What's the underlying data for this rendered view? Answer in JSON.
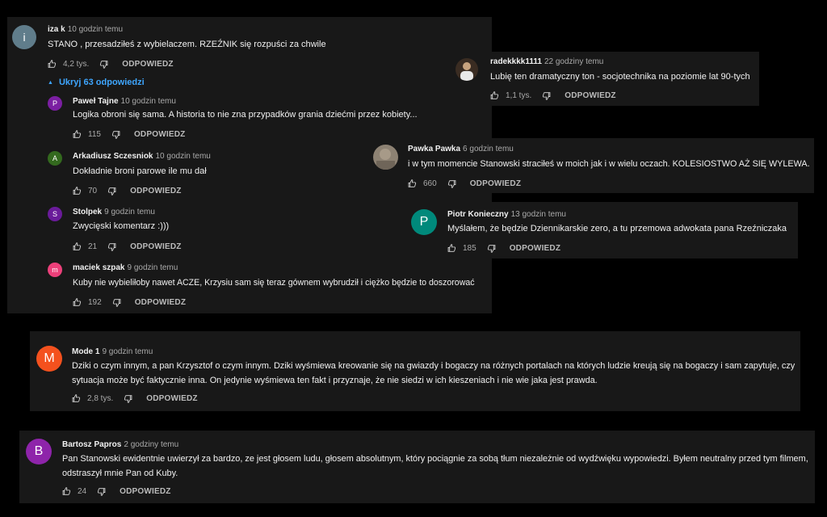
{
  "reply_label": "ODPOWIEDZ",
  "thread": {
    "top": {
      "author": "iza k",
      "time": "10 godzin temu",
      "text": "STANO , przesadziłeś  z wybielaczem. RZEŹNIK się  rozpuści za chwile",
      "likes": "4,2 tys.",
      "avatar_letter": "i",
      "avatar_color": "#607d8b"
    },
    "toggle_label": "Ukryj 63 odpowiedzi",
    "replies": [
      {
        "author": "Paweł Tajne",
        "time": "10 godzin temu",
        "text": "Logika obroni się sama. A historia to nie zna przypadków grania dziećmi przez kobiety...",
        "likes": "115",
        "avatar_letter": "P",
        "avatar_color": "#7b1fa2"
      },
      {
        "author": "Arkadiusz Sczesniok",
        "time": "10 godzin temu",
        "text": "Dokładnie broni parowe ile mu dał",
        "likes": "70",
        "avatar_letter": "A",
        "avatar_color": "#33691e"
      },
      {
        "author": "Stolpek",
        "time": "9 godzin temu",
        "text": "Zwycięski komentarz :)))",
        "likes": "21",
        "avatar_letter": "S",
        "avatar_color": "#6a1b9a"
      },
      {
        "author": "maciek szpak",
        "time": "9 godzin temu",
        "text": "Kuby nie wybieliłoby nawet ACZE, Krzysiu sam się teraz gównem wybrudził i ciężko będzie to doszorować",
        "likes": "192",
        "avatar_letter": "m",
        "avatar_color": "#ec407a"
      }
    ]
  },
  "radek": {
    "author": "radekkkk1111",
    "time": "22 godziny temu",
    "text": "Lubię ten dramatyczny ton - socjotechnika na poziomie lat 90-tych",
    "likes": "1,1 tys.",
    "avatar_color": "#3a2c22"
  },
  "pawka": {
    "author": "Pawka Pawka",
    "time": "6 godzin temu",
    "text": "i w tym momencie Stanowski straciłeś w moich jak i w wielu oczach. KOLESIOSTWO AŻ SIĘ WYLEWA.",
    "likes": "660",
    "avatar_color": "#8d8273"
  },
  "piotr": {
    "author": "Piotr Konieczny",
    "time": "13 godzin temu",
    "text": "Myślałem, że będzie Dziennikarskie zero, a tu przemowa adwokata pana Rzeźniczaka",
    "likes": "185",
    "avatar_letter": "P",
    "avatar_color": "#00897b"
  },
  "mode": {
    "author": "Mode 1",
    "time": "9 godzin temu",
    "text": "Dziki o czym innym, a pan Krzysztof o czym innym. Dziki wyśmiewa kreowanie się na gwiazdy i bogaczy na różnych portalach na których ludzie kreują się na bogaczy i sam zapytuje, czy sytuacja może być faktycznie inna. On jedynie wyśmiewa ten fakt i przyznaje, że nie siedzi w ich kieszeniach i nie wie jaka jest prawda.",
    "likes": "2,8 tys.",
    "avatar_letter": "M",
    "avatar_color": "#f4511e"
  },
  "bartosz": {
    "author": "Bartosz Papros",
    "time": "2 godziny temu",
    "text": "Pan Stanowski ewidentnie uwierzył za bardzo, ze jest głosem ludu, głosem absolutnym, który pociągnie za sobą tłum niezależnie od wydźwięku wypowiedzi. Byłem neutralny przed tym filmem, odstraszył mnie Pan od Kuby.",
    "likes": "24",
    "avatar_letter": "B",
    "avatar_color": "#8e24aa"
  }
}
